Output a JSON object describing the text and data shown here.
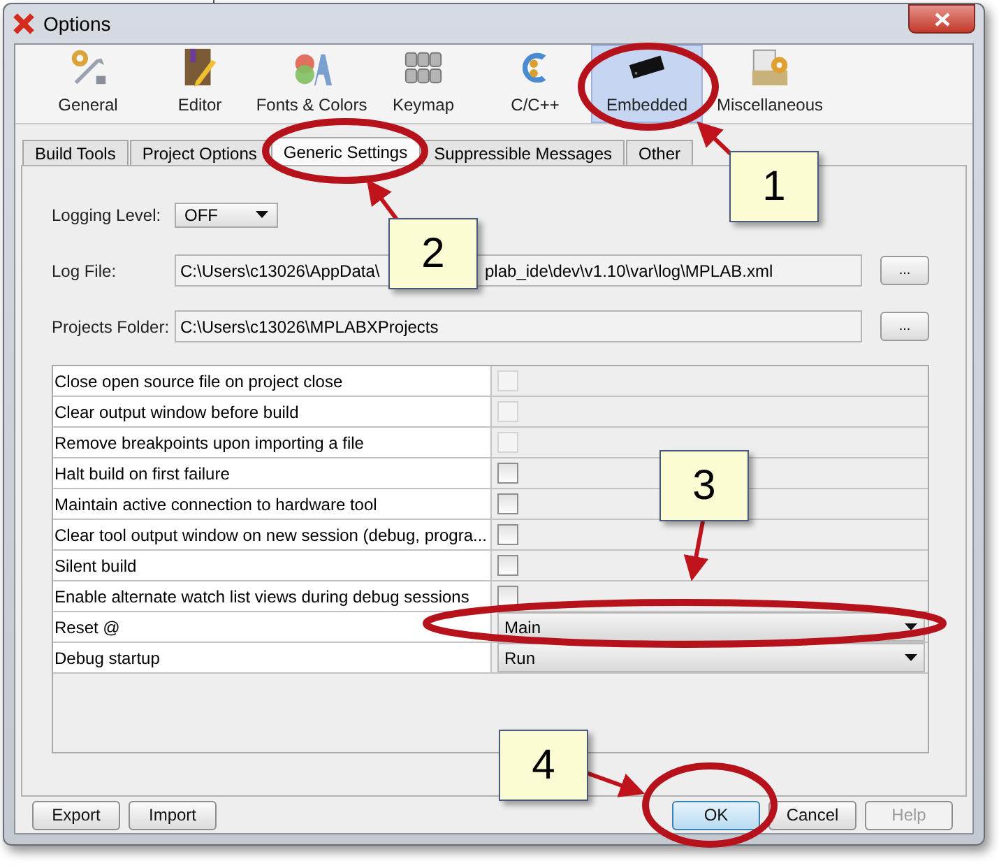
{
  "window": {
    "title": "Options"
  },
  "categories": [
    {
      "label": "General",
      "selected": false
    },
    {
      "label": "Editor",
      "selected": false
    },
    {
      "label": "Fonts & Colors",
      "selected": false
    },
    {
      "label": "Keymap",
      "selected": false
    },
    {
      "label": "C/C++",
      "selected": false
    },
    {
      "label": "Embedded",
      "selected": true
    },
    {
      "label": "Miscellaneous",
      "selected": false
    }
  ],
  "tabs": [
    {
      "label": "Build Tools",
      "selected": false
    },
    {
      "label": "Project Options",
      "selected": false
    },
    {
      "label": "Generic Settings",
      "selected": true
    },
    {
      "label": "Suppressible Messages",
      "selected": false
    },
    {
      "label": "Other",
      "selected": false
    }
  ],
  "logging_level": {
    "label": "Logging Level:",
    "value": "OFF"
  },
  "log_file": {
    "label": "Log File:",
    "value_start": "C:\\Users\\c13026\\AppData\\",
    "value_end": "plab_ide\\dev\\v1.10\\var\\log\\MPLAB.xml",
    "button": "..."
  },
  "projects_folder": {
    "label": "Projects Folder:",
    "value": "C:\\Users\\c13026\\MPLABXProjects",
    "button": "..."
  },
  "settings": [
    {
      "kind": "checkbox",
      "label": "Close open source file on project close",
      "checked": false,
      "disabled": true
    },
    {
      "kind": "checkbox",
      "label": "Clear output window before build",
      "checked": false,
      "disabled": true
    },
    {
      "kind": "checkbox",
      "label": "Remove breakpoints upon importing a file",
      "checked": false,
      "disabled": true
    },
    {
      "kind": "checkbox",
      "label": "Halt build on first failure",
      "checked": false,
      "disabled": false
    },
    {
      "kind": "checkbox",
      "label": "Maintain active connection to hardware tool",
      "checked": false,
      "disabled": false
    },
    {
      "kind": "checkbox",
      "label": "Clear tool output window on new session (debug, progra...",
      "checked": false,
      "disabled": false
    },
    {
      "kind": "checkbox",
      "label": "Silent build",
      "checked": false,
      "disabled": false
    },
    {
      "kind": "checkbox",
      "label": "Enable alternate watch list views during debug sessions",
      "checked": false,
      "disabled": false
    },
    {
      "kind": "dropdown",
      "label": "Reset @",
      "value": "Main"
    },
    {
      "kind": "dropdown",
      "label": "Debug startup",
      "value": "Run"
    }
  ],
  "buttons_left": [
    {
      "label": "Export",
      "disabled": false
    },
    {
      "label": "Import",
      "disabled": false
    }
  ],
  "buttons_right": [
    {
      "label": "OK",
      "disabled": false,
      "default": true
    },
    {
      "label": "Cancel",
      "disabled": false,
      "default": false
    },
    {
      "label": "Help",
      "disabled": true,
      "default": false
    }
  ],
  "callouts": [
    "1",
    "2",
    "3",
    "4"
  ]
}
